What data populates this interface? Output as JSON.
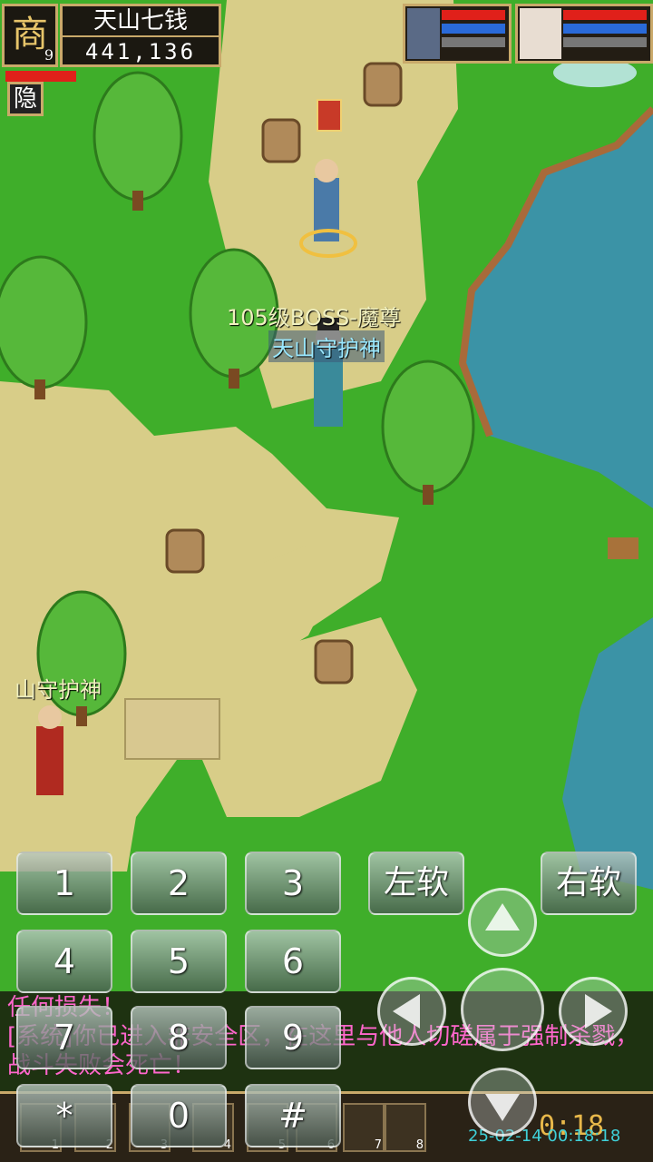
{
  "player": {
    "portrait_glyph": "商",
    "level": "9",
    "name": "天山七钱",
    "gold": "441,136",
    "hide_label": "隐"
  },
  "world_labels": {
    "boss_name": "105级BOSS-魔尊",
    "boss_guard_title": "天山守护神",
    "npc_guard_title": "山守护神"
  },
  "keypad": {
    "keys": [
      "1",
      "2",
      "3",
      "4",
      "5",
      "6",
      "7",
      "8",
      "9",
      "*",
      "0",
      "#"
    ],
    "left_soft": "左软",
    "right_soft": "右软"
  },
  "chat": {
    "line1": "任何损失！",
    "line2": "[系统]你已进入非安全区，在这里与他人切磋属于强制杀戮，",
    "line3": "战斗失败会死亡！",
    "color": "#ff66cc"
  },
  "toolbar": {
    "slot_numbers": [
      "1",
      "2",
      "3",
      "4",
      "5",
      "6",
      "7",
      "8"
    ],
    "timer": "0:18",
    "timestamp": "25-02-14 00:18:18"
  },
  "colors": {
    "grass": "#3fae2a",
    "path": "#d8cd88",
    "water": "#3b93a6",
    "frame_gold": "#c9a96a"
  }
}
